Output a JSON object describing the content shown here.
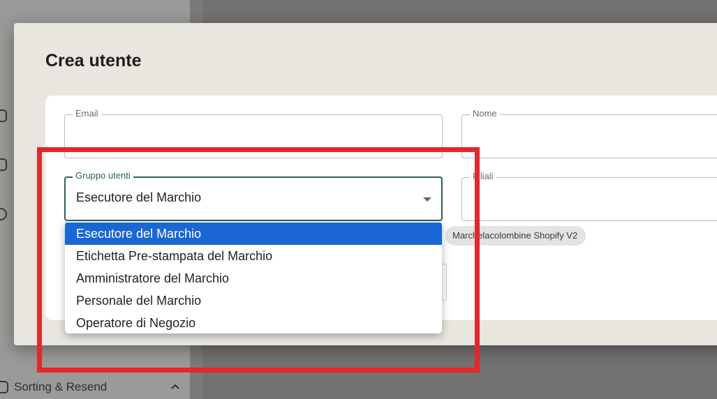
{
  "background": {
    "sidebar_item_label": "Sorting & Resend"
  },
  "modal": {
    "title": "Crea utente"
  },
  "form": {
    "email": {
      "label": "Email",
      "value": ""
    },
    "nome": {
      "label": "Nome",
      "value": ""
    },
    "gruppo_utenti": {
      "label": "Gruppo utenti",
      "value": "Esecutore del Marchio"
    },
    "filiali": {
      "label": "Filiali",
      "value": ""
    },
    "chip": "Marchelacolombine Shopify V2"
  },
  "dropdown": {
    "options": [
      "Esecutore del Marchio",
      "Etichetta Pre-stampata del Marchio",
      "Amministratore del Marchio",
      "Personale del Marchio",
      "Operatore di Negozio"
    ],
    "selected_index": 0
  },
  "colors": {
    "accent_focus": "#2e5e5a",
    "selected_option": "#1a66d2",
    "annotation": "#e5262a"
  }
}
